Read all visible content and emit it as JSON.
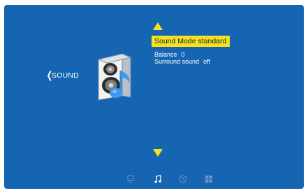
{
  "header": {
    "page_label": "SOUND"
  },
  "menu": {
    "selected": {
      "label": "Sound Mode",
      "value": "standard"
    },
    "items": [
      {
        "label": "Balance",
        "value": "0"
      },
      {
        "label": "Surround sound",
        "value": "off"
      }
    ]
  },
  "bottom_tabs": [
    {
      "name": "picture",
      "icon": "tv-icon",
      "active": false
    },
    {
      "name": "sound",
      "icon": "music-note-icon",
      "active": true
    },
    {
      "name": "time",
      "icon": "clock-icon",
      "active": false
    },
    {
      "name": "setup",
      "icon": "grid-icon",
      "active": false
    }
  ],
  "colors": {
    "background": "#1665b3",
    "highlight": "#f5e21b",
    "text": "#ffffff",
    "inactive_icon": "#6a95cd"
  }
}
